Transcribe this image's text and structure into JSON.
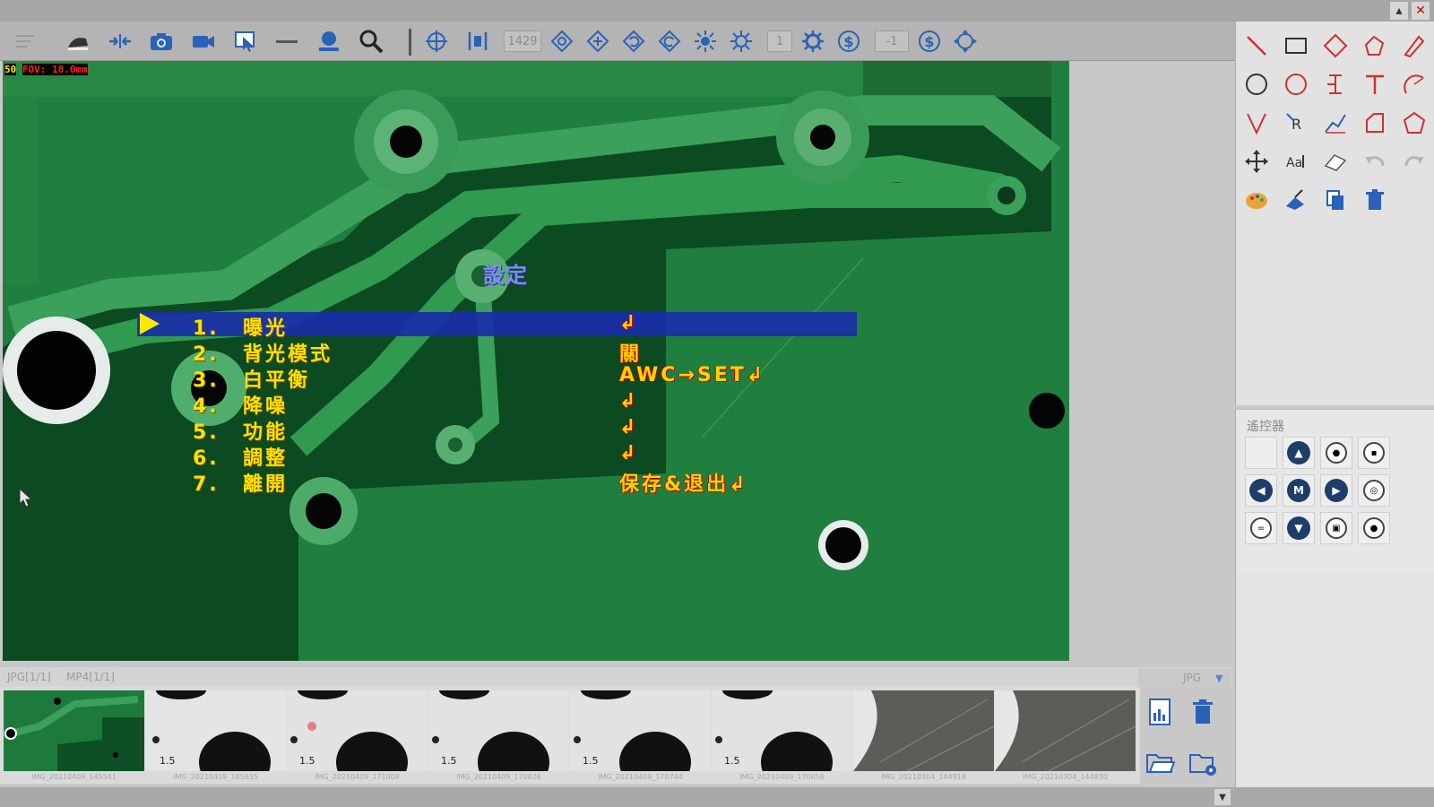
{
  "window": {
    "scroll_up_label": "▴",
    "close_label": "✕"
  },
  "toolbar": {
    "exposure_value": "1429",
    "field_a": "1",
    "field_b": "-1"
  },
  "video": {
    "fov_prefix": "50",
    "fov_value": "FOV: 18.0mm",
    "osd": {
      "title": "設定",
      "items": [
        {
          "num": "1.",
          "label": "曝光",
          "value": "↲"
        },
        {
          "num": "2.",
          "label": "背光模式",
          "value": "關"
        },
        {
          "num": "3.",
          "label": "白平衡",
          "value": "AWC→SET↲"
        },
        {
          "num": "4.",
          "label": "降噪",
          "value": "↲"
        },
        {
          "num": "5.",
          "label": "功能",
          "value": "↲"
        },
        {
          "num": "6.",
          "label": "調整",
          "value": "↲"
        },
        {
          "num": "7.",
          "label": "離開",
          "value": "保存&退出↲"
        }
      ]
    }
  },
  "controller": {
    "title": "遙控器"
  },
  "gallery": {
    "tabs": [
      {
        "label": "JPG[1/1]"
      },
      {
        "label": "MP4[1/1]"
      }
    ],
    "filter_value": "JPG",
    "thumbnails": [
      {
        "name": "IMG_20210409_145541"
      },
      {
        "name": "IMG_20210409_145635"
      },
      {
        "name": "IMG_20210409_171008"
      },
      {
        "name": "IMG_20210409_170826"
      },
      {
        "name": "IMG_20210409_170744"
      },
      {
        "name": "IMG_20210409_170656"
      },
      {
        "name": "IMG_20210304_144918"
      },
      {
        "name": "IMG_20210304_144830"
      }
    ]
  },
  "colors": {
    "board_green": "#1e7a3a",
    "osd_yellow": "#ffe000",
    "osd_highlight": "#1a2ea8",
    "tool_red": "#d03030",
    "icon_blue": "#2a62b8"
  }
}
